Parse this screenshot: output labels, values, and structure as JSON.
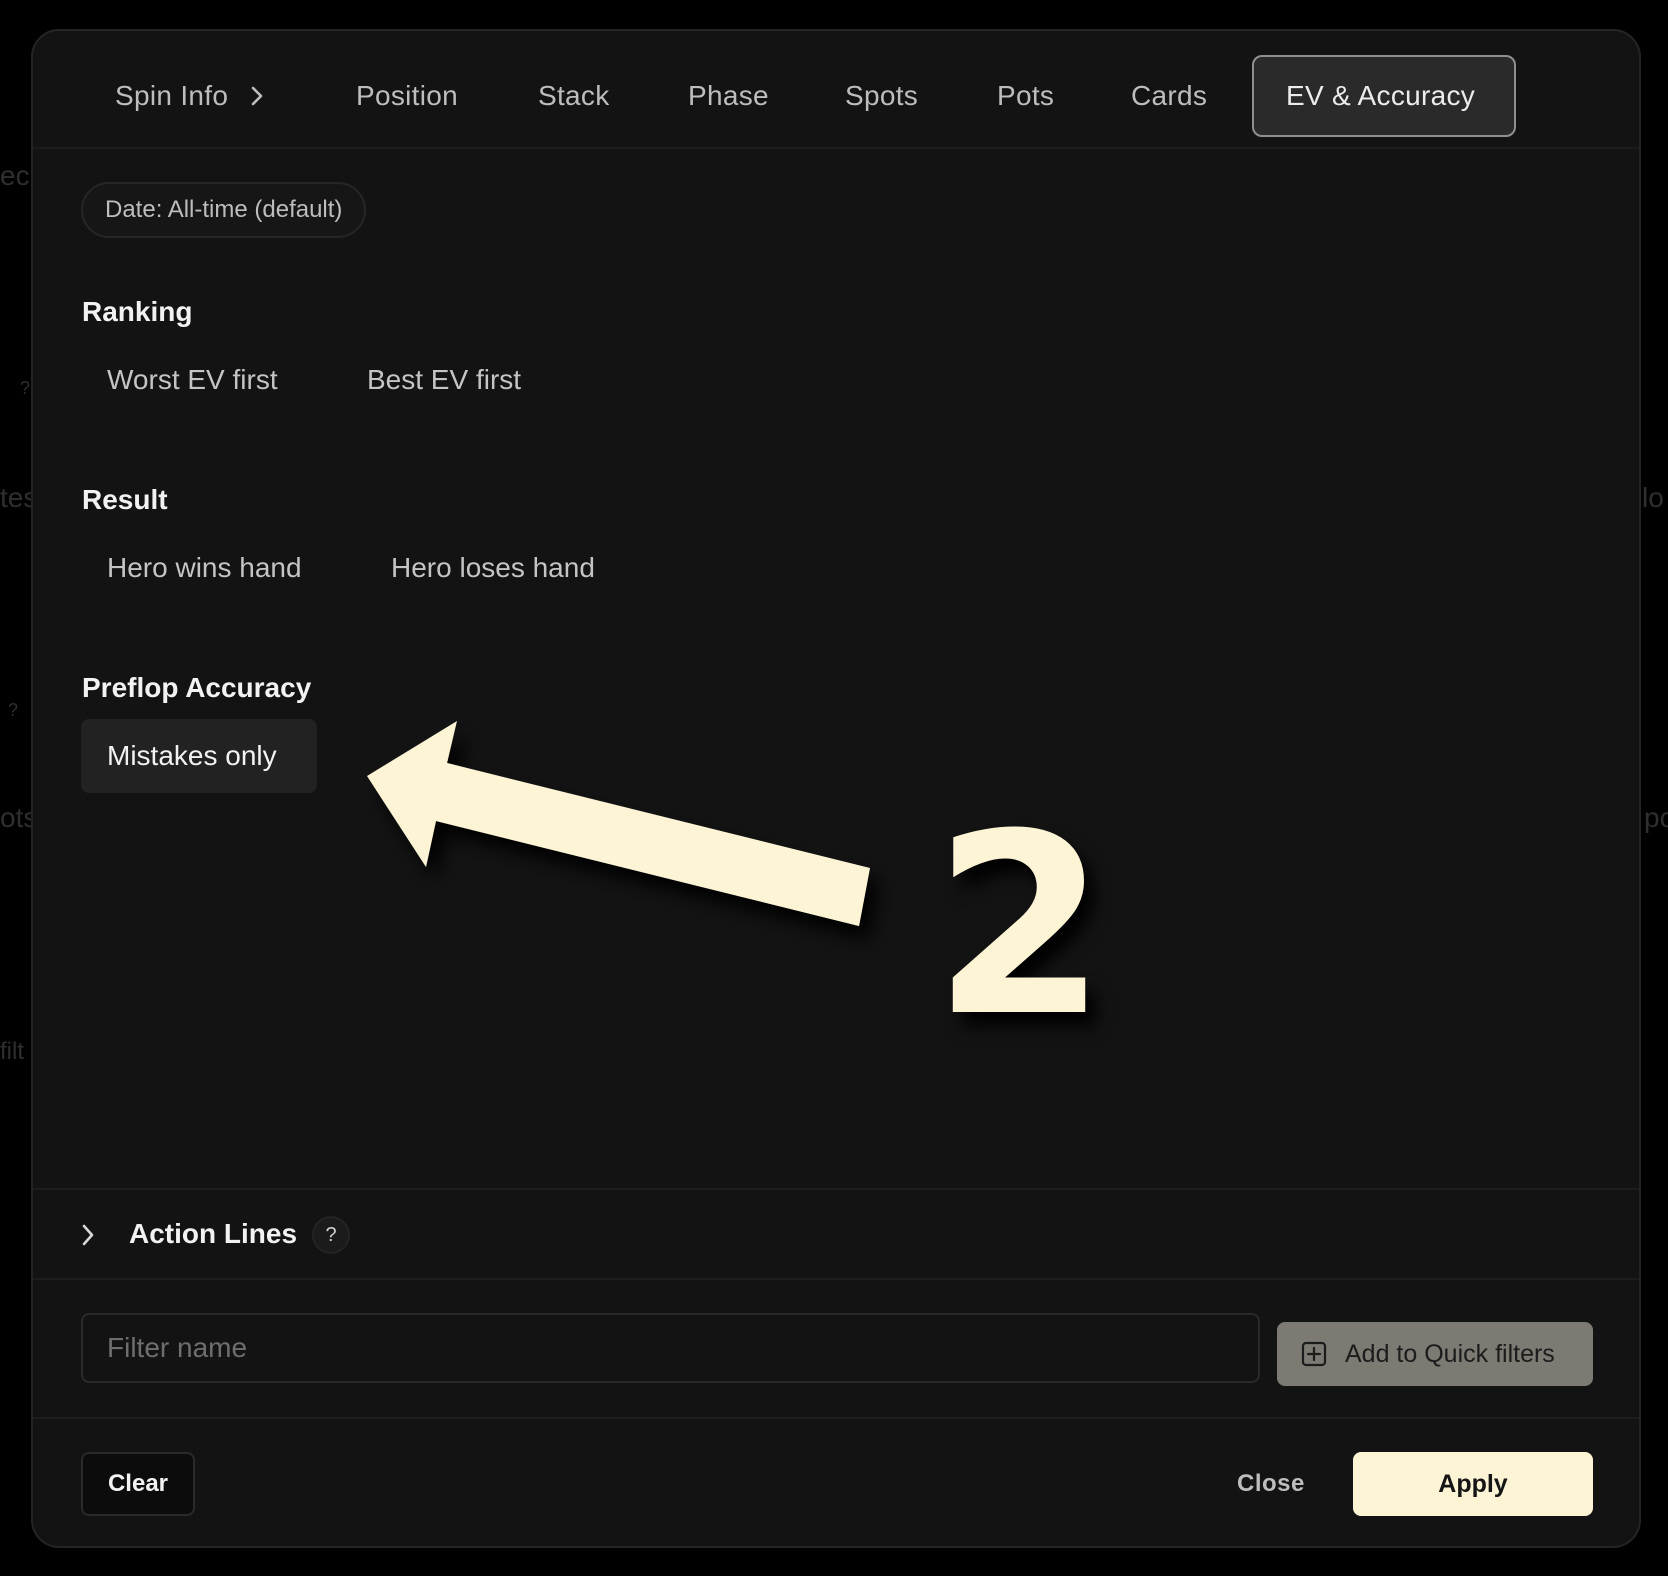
{
  "background_fragments": {
    "f1": "ec",
    "f2": "?",
    "f3": "tes",
    "f4": "?",
    "f5": "ots",
    "f6": "filt",
    "f7": "lo",
    "f8": "po"
  },
  "tabs": [
    {
      "label": "Spin Info",
      "icon": "chevron-right-icon"
    },
    {
      "label": "Position"
    },
    {
      "label": "Stack"
    },
    {
      "label": "Phase"
    },
    {
      "label": "Spots"
    },
    {
      "label": "Pots"
    },
    {
      "label": "Cards"
    },
    {
      "label": "EV & Accuracy",
      "active": true
    }
  ],
  "date_filter": "Date: All-time (default)",
  "sections": {
    "ranking": {
      "title": "Ranking",
      "options": [
        "Worst EV first",
        "Best EV first"
      ]
    },
    "result": {
      "title": "Result",
      "options": [
        "Hero wins hand",
        "Hero loses hand"
      ]
    },
    "preflop": {
      "title": "Preflop Accuracy",
      "options": [
        "Mistakes only"
      ],
      "selected": "Mistakes only"
    }
  },
  "annotation": {
    "number": "2",
    "icon": "arrow-left-icon",
    "color": "#fdf4d6"
  },
  "action_lines": {
    "title": "Action Lines",
    "help": "?",
    "icon": "chevron-right-icon"
  },
  "filter_name": {
    "placeholder": "Filter name",
    "value": ""
  },
  "quick_filters": {
    "label": "Add to Quick filters",
    "icon": "plus-square-icon"
  },
  "footer": {
    "clear": "Clear",
    "close": "Close",
    "apply": "Apply"
  },
  "colors": {
    "background": "#000000",
    "panel": "#131313",
    "accent": "#fdf4d6",
    "active_tab_bg": "#2a2a2a",
    "quick_btn_bg": "#7c7a72"
  }
}
